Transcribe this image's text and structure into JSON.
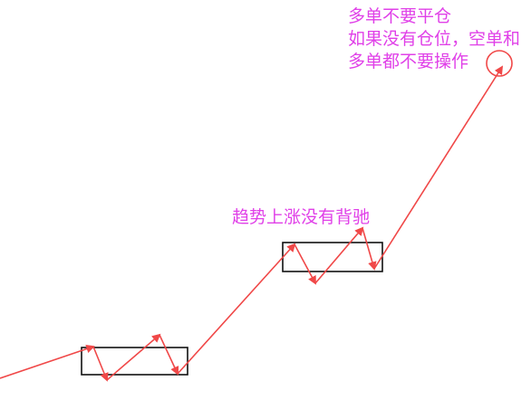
{
  "annotations": {
    "top_lines": [
      "多单不要平仓",
      "如果没有仓位，空单和",
      "多单都不要操作"
    ],
    "middle": "趋势上涨没有背驰"
  },
  "colors": {
    "annotation_text": "#e040e8",
    "trend_line": "#f04848",
    "consolidation_box": "#111111",
    "background": "#ffffff"
  }
}
